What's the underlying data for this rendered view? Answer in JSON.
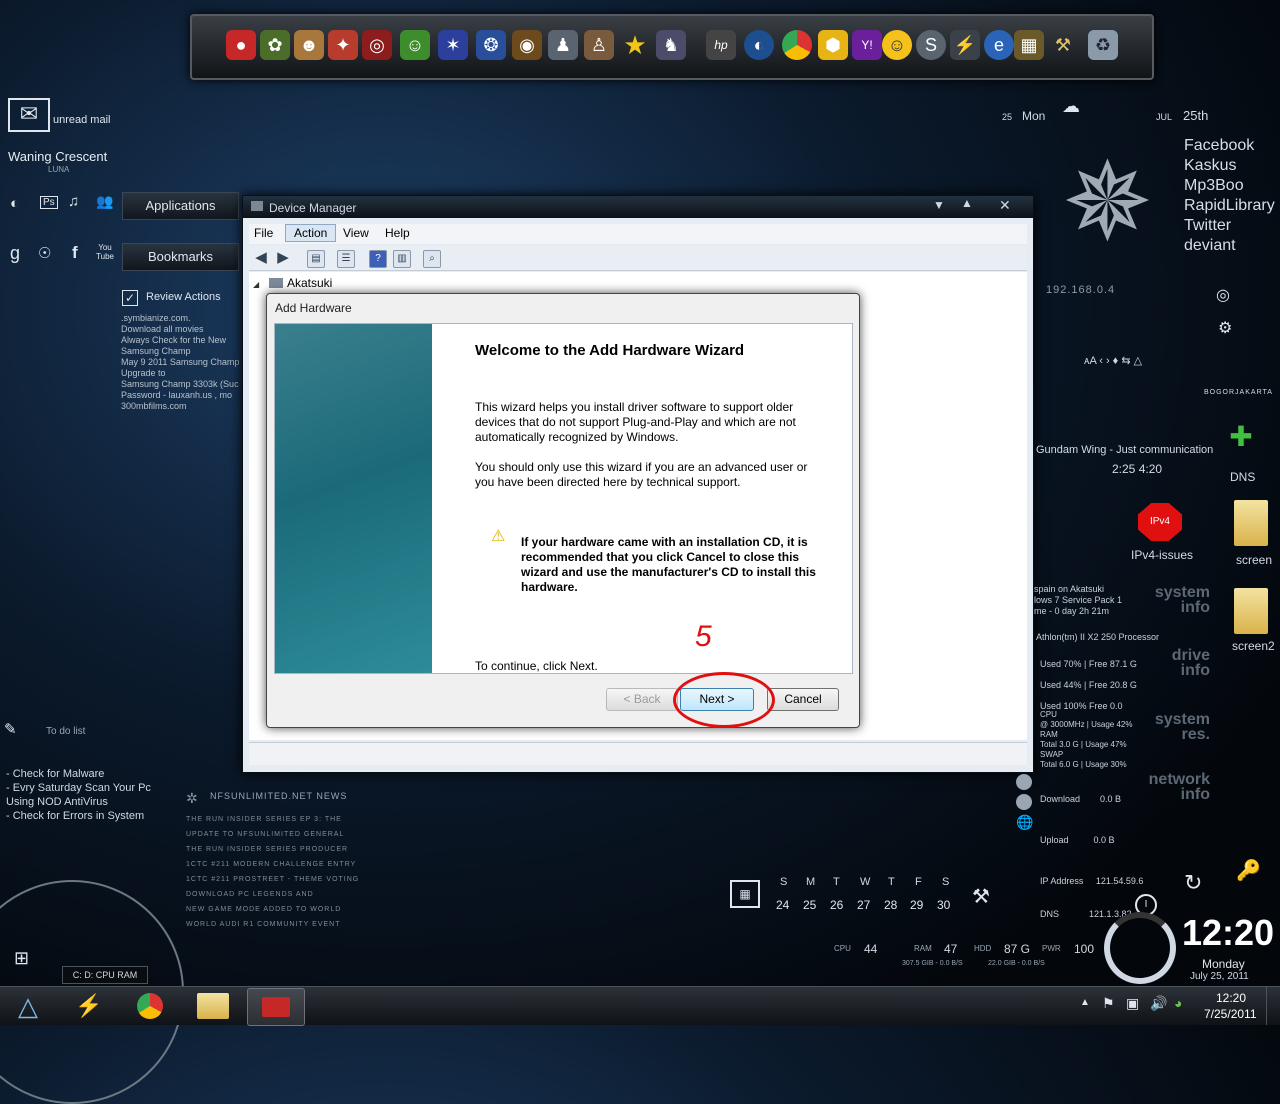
{
  "dock": {
    "icons": [
      "angry-birds-icon",
      "flower-icon",
      "game1-icon",
      "game2-icon",
      "game3-icon",
      "alien-icon",
      "game4-icon",
      "game5-icon",
      "game6-icon",
      "game7-icon",
      "game8-icon",
      "star-icon",
      "game9-icon",
      "hp-icon",
      "firefox-icon",
      "chrome-icon",
      "hex-icon",
      "yahoo-icon",
      "emoticon-icon",
      "skype-icon",
      "lightning-icon",
      "ie-icon",
      "chip-icon",
      "tools-icon",
      "recycle-icon"
    ]
  },
  "left_panel": {
    "mail_label": "unread mail",
    "moon_title": "Waning Crescent",
    "moon_sub": "LUNA",
    "applications": "Applications",
    "bookmarks": "Bookmarks",
    "review_actions": "Review Actions",
    "review_lines": [
      ".symbianize.com.",
      "Download all movies",
      "Always Check for the New",
      "Samsung Champ",
      "May 9 2011 Samsung Champ",
      "Upgrade to",
      "Samsung Champ 3303k (Suc",
      "Password - lauxanh.us , mo",
      "300mbfilms.com"
    ],
    "todo_title": "To do list",
    "todo_items": [
      "- Check for Malware",
      "- Evry Saturday Scan Your Pc",
      "Using NOD AntiVirus",
      "- Check for Errors in System"
    ],
    "news_title": "NFSUNLIMITED.NET NEWS",
    "news_items": [
      "THE RUN INSIDER SERIES EP 3: THE",
      "UPDATE TO NFSUNLIMITED GENERAL",
      "THE RUN INSIDER SERIES PRODUCER",
      "1CTC #211 MODERN CHALLENGE ENTRY",
      "1CTC #211 PROSTREET - THEME VOTING",
      "DOWNLOAD PC LEGENDS AND",
      "NEW GAME MODE ADDED TO WORLD",
      "WORLD AUDI R1 COMMUNITY EVENT"
    ],
    "drive_bar": "C:  D:  CPU  RAM"
  },
  "devmgr": {
    "title": "Device Manager",
    "menu": [
      "File",
      "Action",
      "View",
      "Help"
    ],
    "tree_root": "Akatsuki"
  },
  "wizard": {
    "title": "Add Hardware",
    "heading": "Welcome to the Add Hardware Wizard",
    "para1": "This wizard helps you install driver software to support older devices that do not support Plug-and-Play and which are not automatically recognized by Windows.",
    "para2": "You should only use this wizard if you are an advanced user or you have been directed here by technical support.",
    "warning": "If your hardware came with an installation CD, it is recommended that you click Cancel to close this wizard and use the manufacturer's CD to install this hardware.",
    "continue": "To continue, click Next.",
    "back": "< Back",
    "next": "Next >",
    "cancel": "Cancel",
    "annotation": "5"
  },
  "right_panel": {
    "date_day": "25",
    "date_dayname": "Mon",
    "date_month": "JUL",
    "date_suffix": "25th",
    "links": [
      "Facebook",
      "Kaskus",
      "Mp3Boo",
      "RapidLibrary",
      "Twitter",
      "deviant"
    ],
    "ip_text": "192.168.0.4",
    "city": "BOGORJAKARTA",
    "player": "Gundam Wing - Just communication",
    "player_time": "2:25  4:20",
    "dns": "DNS",
    "ipv4_badge": "IPv4",
    "ipv4_label": "IPv4-issues",
    "screen1": "screen",
    "screen2": "screen2",
    "sys_lines": [
      "spain on Akatsuki",
      "lows 7 Service Pack 1",
      "me - 0 day 2h 21m"
    ],
    "sys_title": "system info",
    "cpu_name": "Athlon(tm) II X2 250 Processor",
    "drive_title": "drive info",
    "drives": [
      "Used 70% | Free 87.1 G",
      "Used 44% | Free 20.8 G",
      "Used 100% Free 0.0"
    ],
    "res_title": "system res.",
    "res_lines": [
      "CPU",
      "@ 3000MHz | Usage 42%",
      "RAM",
      "Total 3.0 G | Usage 47%",
      "SWAP",
      "Total 6.0 G | Usage 30%"
    ],
    "net_title": "network info",
    "net_lines": [
      "Download        0.0 B",
      "Upload          0.0 B",
      "IP Address     121.54.59.6",
      "DNS            121.1.3.82"
    ]
  },
  "calendar": {
    "days": [
      "S",
      "M",
      "T",
      "W",
      "T",
      "F",
      "S"
    ],
    "dates": [
      "24",
      "25",
      "26",
      "27",
      "28",
      "29",
      "30"
    ]
  },
  "stats": {
    "cpu_label": "CPU",
    "cpu_value": "44",
    "ram_label": "RAM",
    "ram_value": "47",
    "hdd_label": "HDD",
    "hdd_value": "87 G",
    "pwr_label": "PWR",
    "pwr_value": "100",
    "sub1": "307.5 GIB -  0.0 B/S",
    "sub2": "22.0 GIB -  0.0 B/S"
  },
  "clock": {
    "time": "12:20",
    "weekday": "Monday",
    "date": "July 25, 2011"
  },
  "taskbar": {
    "time": "12:20",
    "date": "7/25/2011"
  }
}
